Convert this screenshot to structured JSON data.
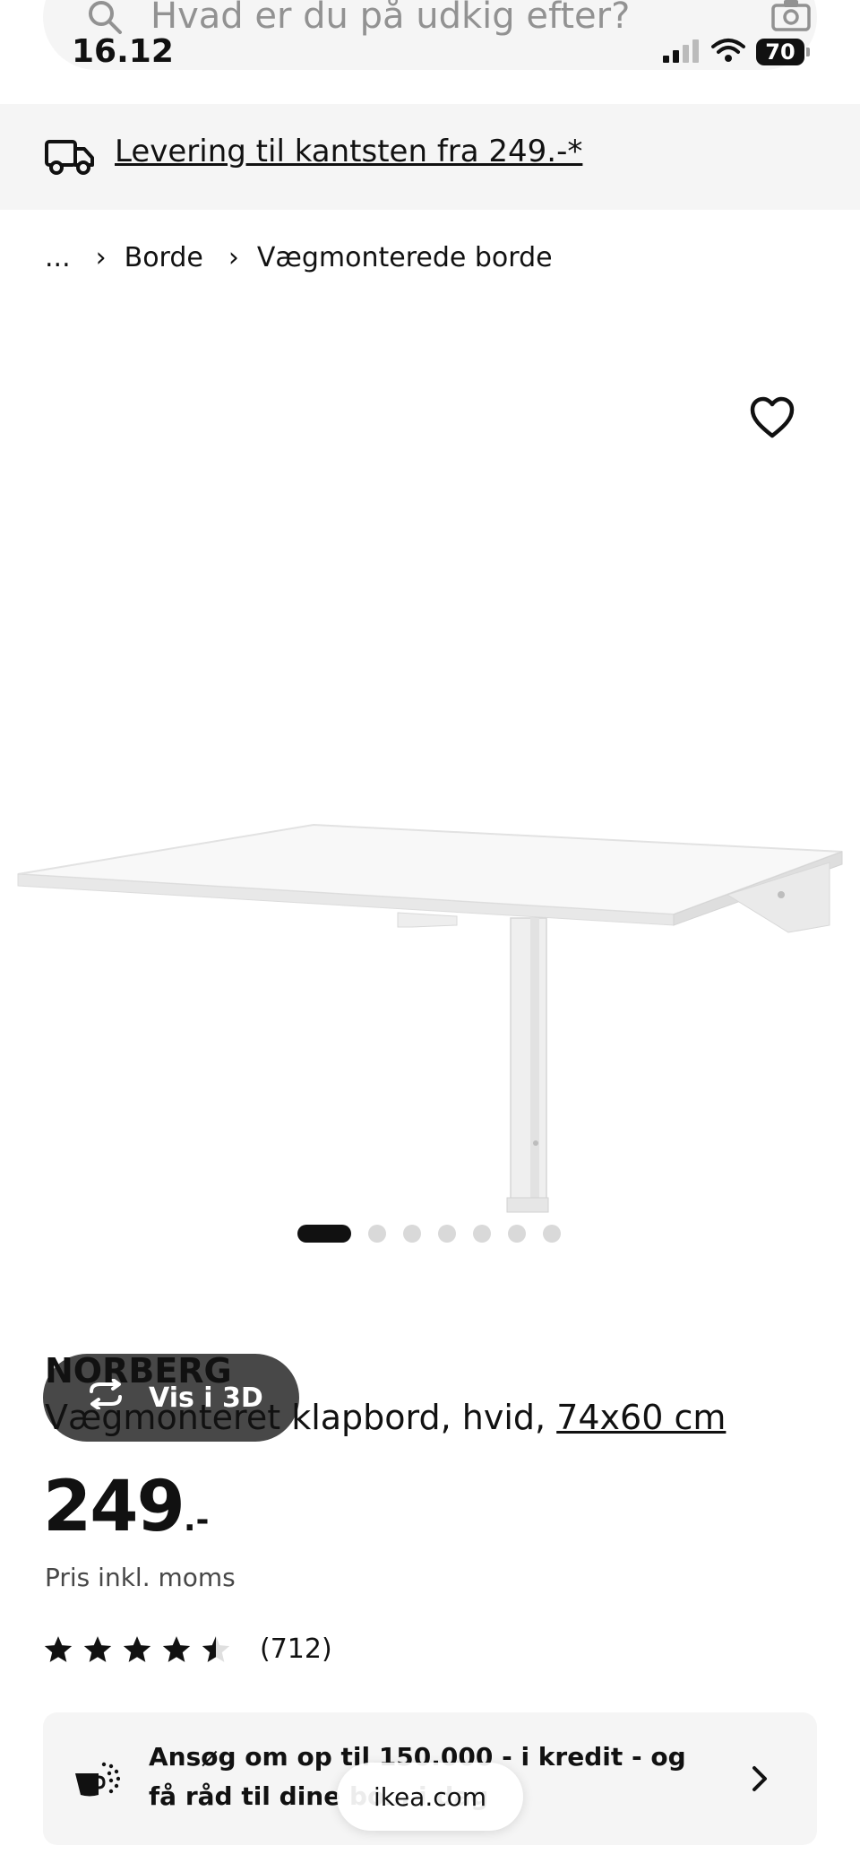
{
  "search": {
    "placeholder": "Hvad er du på udkig efter?"
  },
  "status_bar": {
    "time": "16.12",
    "battery": "70"
  },
  "delivery_banner": {
    "text": "Levering til kantsten fra 249.-*"
  },
  "breadcrumb": {
    "ellipsis": "...",
    "items": [
      "Borde",
      "Vægmonterede borde"
    ]
  },
  "media": {
    "view_3d_label": "Vis i 3D",
    "image_count": 7,
    "active_image": 1
  },
  "product": {
    "name": "NORBERG",
    "description": "Vægmonteret klapbord, hvid, ",
    "measurements": "74x60 cm",
    "price": "249",
    "price_suffix": ".-",
    "price_note": "Pris inkl. moms",
    "rating_value": 4.5,
    "rating_max": 5,
    "rating_count": "(712)"
  },
  "credit": {
    "text": "Ansøg om op til 150.000 - i kredit - og få råd til dine bo… i dag"
  },
  "browser": {
    "domain": "ikea.com"
  },
  "colors": {
    "accent_dark": "#484848",
    "surface": "#f5f5f5",
    "text": "#111111"
  }
}
